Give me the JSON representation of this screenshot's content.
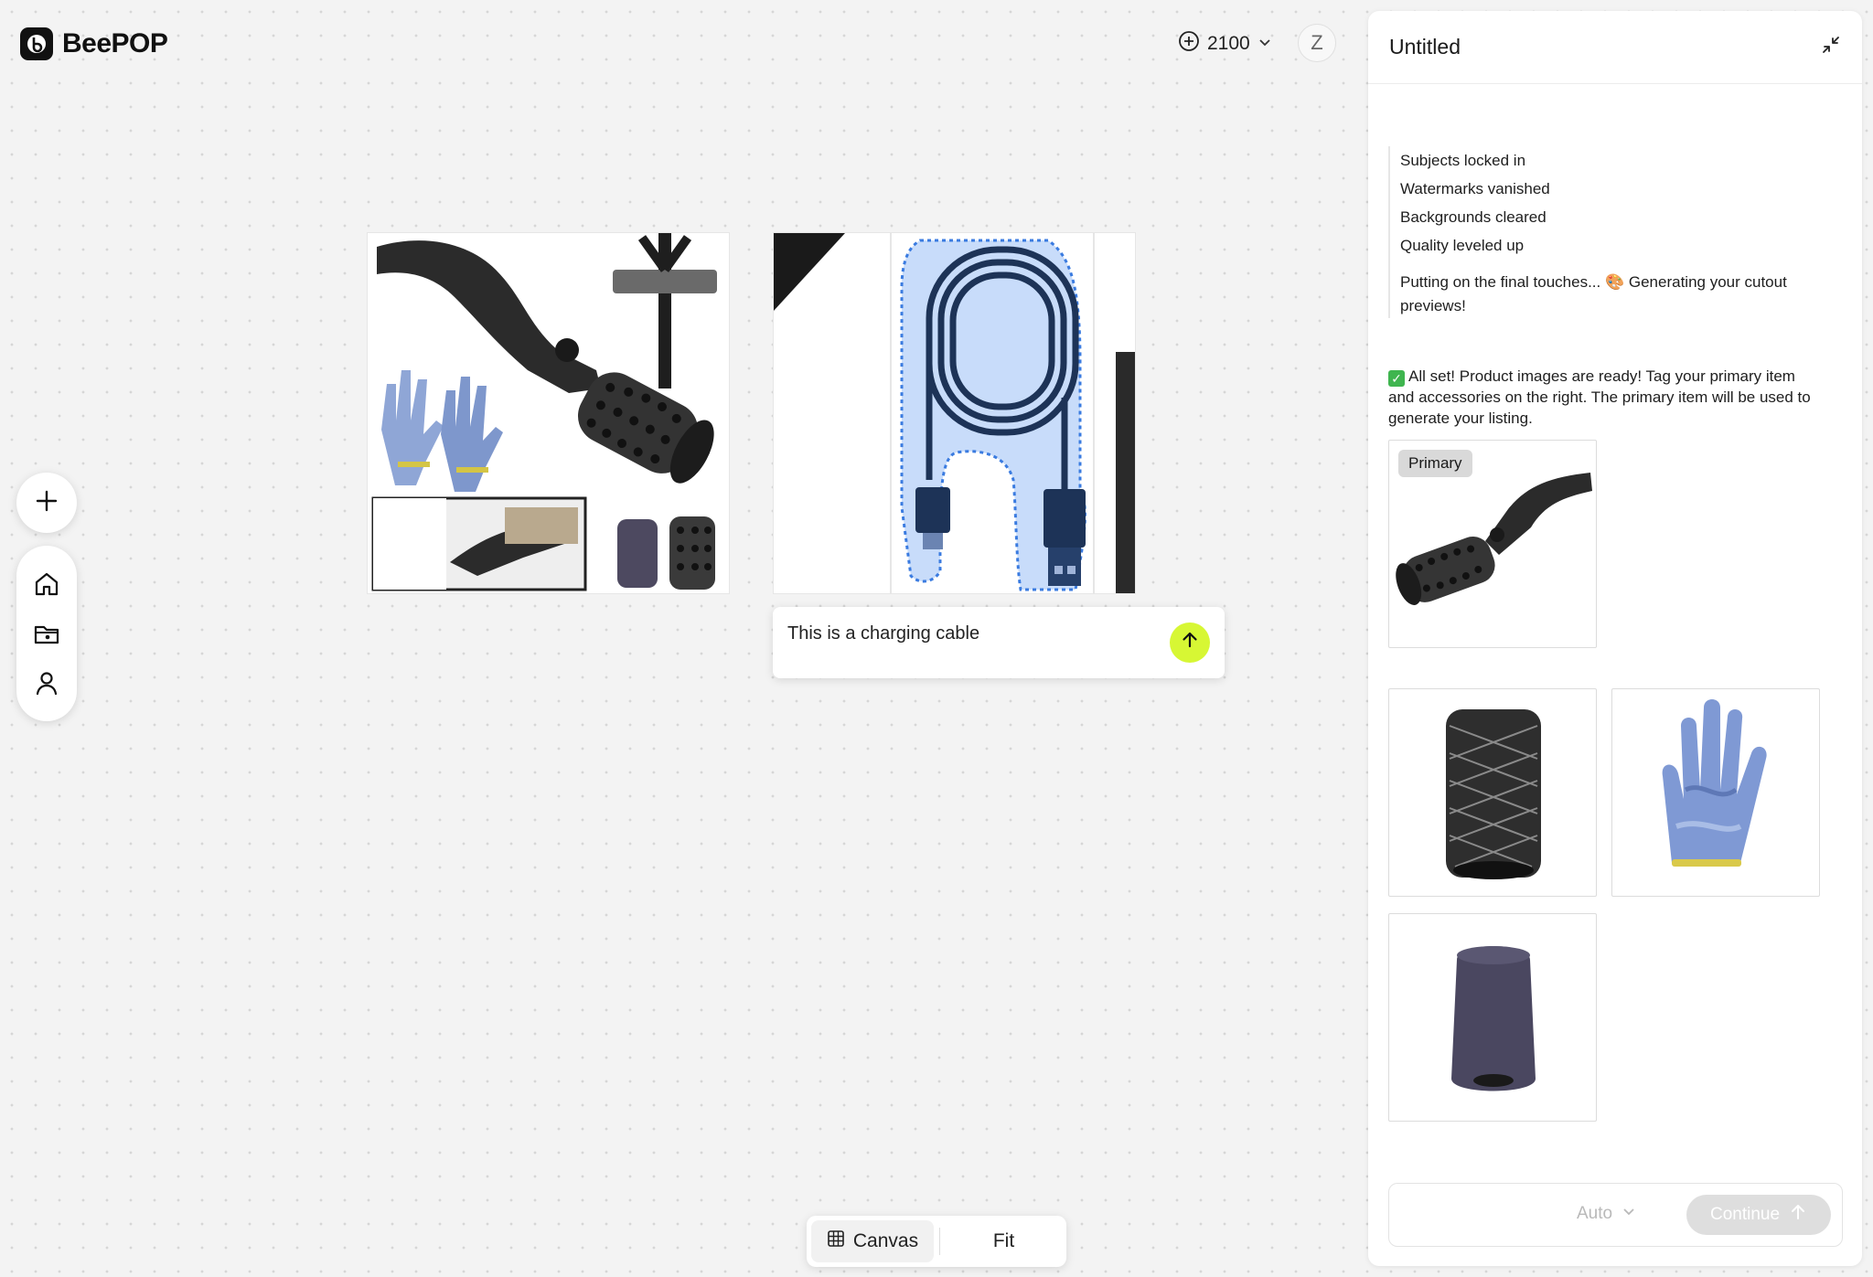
{
  "app": {
    "name": "BeePOP",
    "logo_icon": "beepop-logo-icon"
  },
  "header": {
    "credits": "2100",
    "avatar_initial": "Z"
  },
  "sidebar": {
    "icons": [
      "add-icon",
      "home-icon",
      "folder-icon",
      "user-icon"
    ]
  },
  "canvas": {
    "prompt_text": "This is a charging cable",
    "accent_color": "#d7f734",
    "selection_color": "#3a7be0"
  },
  "view_toggle": {
    "canvas_label": "Canvas",
    "fit_label": "Fit"
  },
  "panel": {
    "title": "Untitled",
    "steps": [
      "Subjects locked in",
      "Watermarks vanished",
      "Backgrounds cleared",
      "Quality leveled up"
    ],
    "final_step": "Putting on the final touches... 🎨 Generating your cutout previews!",
    "done_message": "All set! Product images are ready! Tag your primary item and accessories on the right. The primary item will be used to generate your listing.",
    "primary_tag": "Primary",
    "mode_label": "Auto",
    "continue_label": "Continue"
  }
}
